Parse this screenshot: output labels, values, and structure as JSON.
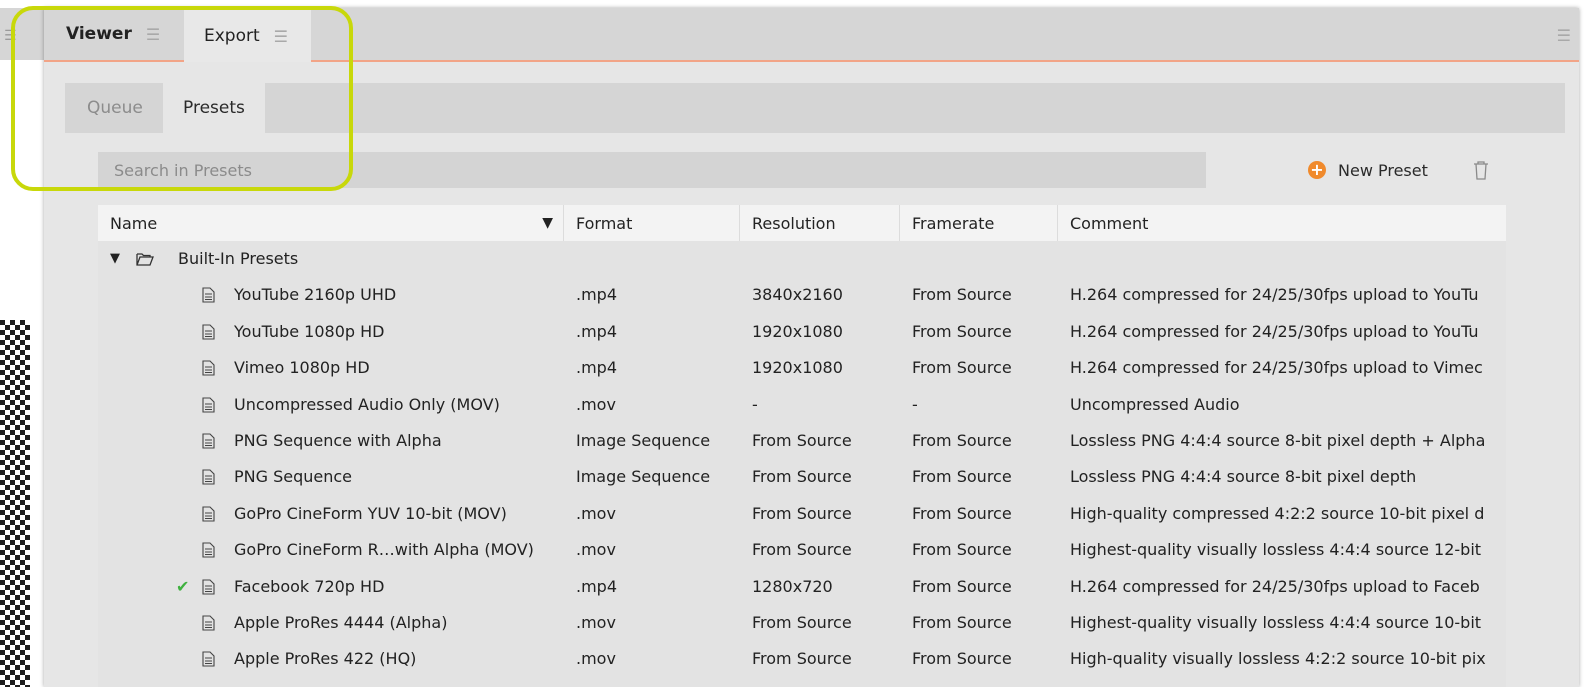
{
  "tabs": [
    {
      "label": "Viewer"
    },
    {
      "label": "Export"
    }
  ],
  "subtabs": [
    {
      "label": "Queue"
    },
    {
      "label": "Presets"
    }
  ],
  "search": {
    "placeholder": "Search in Presets"
  },
  "toolbar": {
    "new_preset_label": "New Preset"
  },
  "table": {
    "columns": [
      "Name",
      "Format",
      "Resolution",
      "Framerate",
      "Comment"
    ],
    "group": "Built-In Presets",
    "rows": [
      {
        "name": "YouTube 2160p UHD",
        "format": ".mp4",
        "resolution": "3840x2160",
        "framerate": "From Source",
        "comment": "H.264 compressed for 24/25/30fps upload to YouTu"
      },
      {
        "name": "YouTube 1080p HD",
        "format": ".mp4",
        "resolution": "1920x1080",
        "framerate": "From Source",
        "comment": "H.264 compressed for 24/25/30fps upload to YouTu"
      },
      {
        "name": "Vimeo 1080p HD",
        "format": ".mp4",
        "resolution": "1920x1080",
        "framerate": "From Source",
        "comment": "H.264 compressed for 24/25/30fps upload to Vimec"
      },
      {
        "name": "Uncompressed Audio Only (MOV)",
        "format": ".mov",
        "resolution": "-",
        "framerate": "-",
        "comment": "Uncompressed Audio"
      },
      {
        "name": "PNG Sequence with Alpha",
        "format": "Image Sequence",
        "resolution": "From Source",
        "framerate": "From Source",
        "comment": "Lossless PNG 4:4:4 source 8-bit pixel depth + Alpha"
      },
      {
        "name": "PNG Sequence",
        "format": "Image Sequence",
        "resolution": "From Source",
        "framerate": "From Source",
        "comment": "Lossless PNG 4:4:4 source 8-bit pixel depth"
      },
      {
        "name": "GoPro CineForm YUV 10-bit (MOV)",
        "format": ".mov",
        "resolution": "From Source",
        "framerate": "From Source",
        "comment": "High-quality compressed 4:2:2 source 10-bit pixel d"
      },
      {
        "name": "GoPro CineForm R…with Alpha (MOV)",
        "format": ".mov",
        "resolution": "From Source",
        "framerate": "From Source",
        "comment": "Highest-quality visually lossless 4:4:4 source 12-bit"
      },
      {
        "name": "Facebook 720p HD",
        "format": ".mp4",
        "resolution": "1280x720",
        "framerate": "From Source",
        "comment": "H.264 compressed for 24/25/30fps upload to Faceb"
      },
      {
        "name": "Apple ProRes 4444 (Alpha)",
        "format": ".mov",
        "resolution": "From Source",
        "framerate": "From Source",
        "comment": "Highest-quality visually lossless 4:4:4 source 10-bit"
      },
      {
        "name": "Apple ProRes 422 (HQ)",
        "format": ".mov",
        "resolution": "From Source",
        "framerate": "From Source",
        "comment": "High-quality visually lossless 4:2:2 source 10-bit pix"
      }
    ]
  },
  "colors": {
    "accent": "#f2a487",
    "highlight": "#c8d80a",
    "plus": "#f08a2c",
    "check": "#3fb13f"
  }
}
